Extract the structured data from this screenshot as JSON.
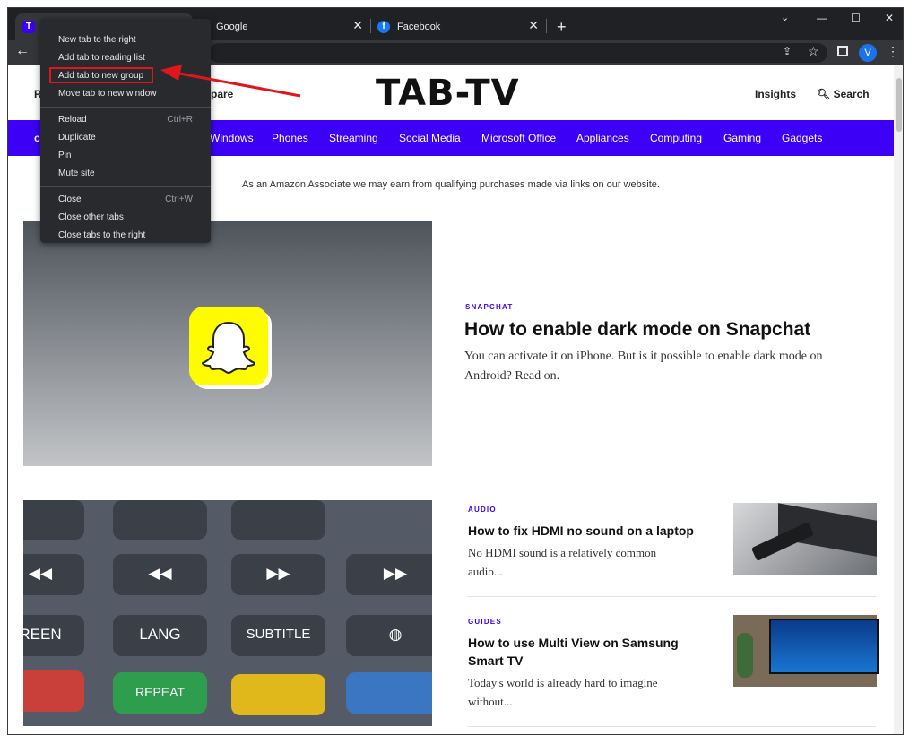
{
  "tabs": [
    {
      "label": "Google",
      "favicon": "google-icon"
    },
    {
      "label": "Facebook",
      "favicon": "facebook-icon"
    }
  ],
  "active_tab_favicon_letter": "T",
  "new_tab_symbol": "+",
  "profile_letter": "V",
  "context_menu": {
    "items": [
      "New tab to the right",
      "Add tab to reading list",
      "Add tab to new group",
      "Move tab to new window",
      "Reload",
      "Duplicate",
      "Pin",
      "Mute site",
      "Close",
      "Close other tabs",
      "Close tabs to the right"
    ],
    "shortcuts": {
      "reload": "Ctrl+R",
      "close": "Ctrl+W"
    },
    "highlighted_item": "Add tab to new group"
  },
  "site": {
    "logo": "TAB-TV",
    "header_left_partial": [
      "R",
      "pare"
    ],
    "header_links": [
      "Insights",
      "Search"
    ],
    "nav_partial": "c",
    "nav": [
      "Windows",
      "Phones",
      "Streaming",
      "Social Media",
      "Microsoft Office",
      "Appliances",
      "Computing",
      "Gaming",
      "Gadgets"
    ],
    "amazon_notice": "As an Amazon Associate we may earn from qualifying purchases made via links on our website."
  },
  "featured": {
    "category": "SNAPCHAT",
    "title": "How to enable dark mode on Snapchat",
    "description_line1": "You can activate it on iPhone. But is it possible to enable dark mode on",
    "description_line2": "Android? Read on."
  },
  "remote_keys": [
    "REEN",
    "LANG",
    "SUBTITLE",
    "REPEAT"
  ],
  "articles": [
    {
      "category": "AUDIO",
      "title": "How to fix HDMI no sound on a laptop",
      "desc_line1": "No HDMI sound is a relatively common",
      "desc_line2": "audio..."
    },
    {
      "category": "GUIDES",
      "title_line1": "How to use Multi View on Samsung",
      "title_line2": "Smart TV",
      "desc_line1": "Today's world is already hard to imagine",
      "desc_line2": "without..."
    }
  ],
  "colors": {
    "accent": "#3b00f5",
    "highlight": "#e0161c",
    "chrome_dark": "#202124"
  }
}
